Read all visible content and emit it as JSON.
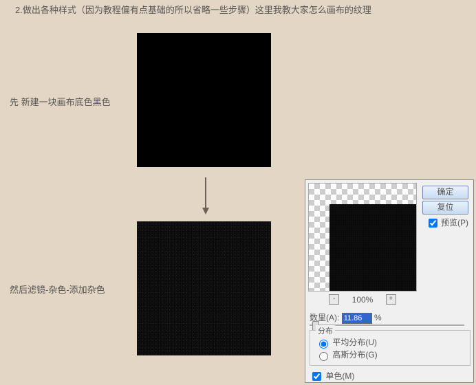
{
  "title": "2.做出各种样式（因为教程偏有点基础的所以省略一些步骤）这里我教大家怎么画布的纹理",
  "step1": "先 新建一块画布底色黑色",
  "step2": "然后滤镜-杂色-添加杂色",
  "dialog": {
    "ok": "确定",
    "reset": "复位",
    "preview_label": "预览(P)",
    "zoom_pct": "100%",
    "amount_label": "数里(A):",
    "amount_value": "11.86",
    "amount_unit": "%",
    "dist_legend": "分布",
    "dist_uniform": "平均分布(U)",
    "dist_gaussian": "高斯分布(G)",
    "mono": "单色(M)"
  }
}
